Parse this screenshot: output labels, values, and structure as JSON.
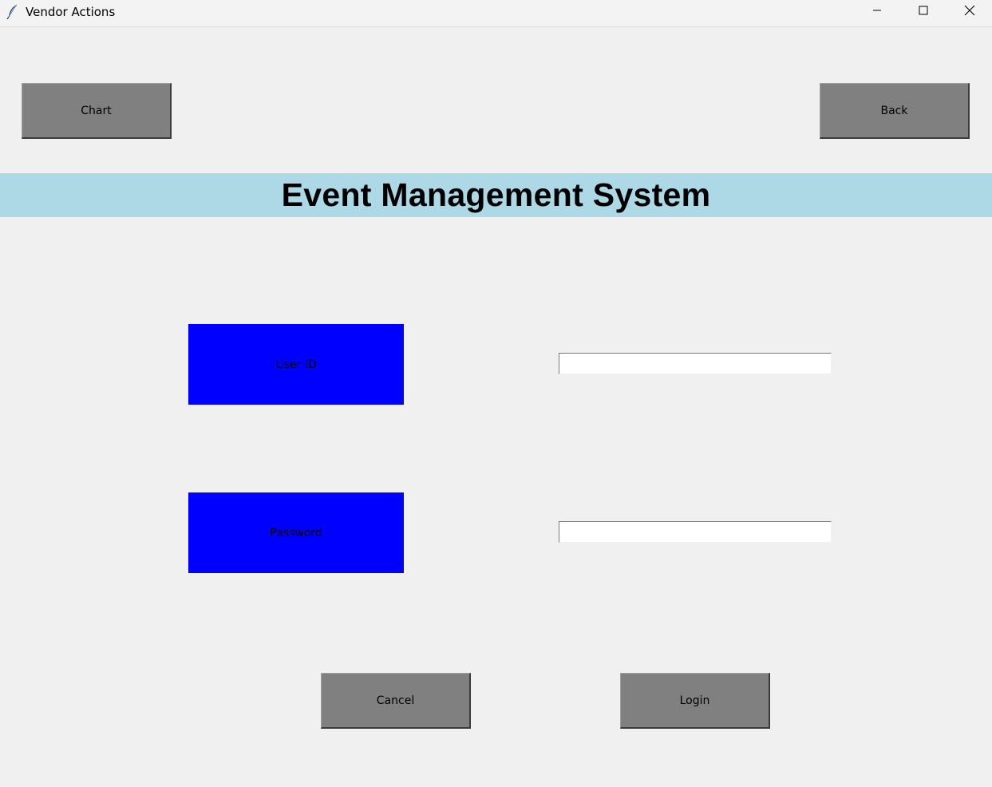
{
  "window": {
    "title": "Vendor Actions",
    "icon": "feather-icon"
  },
  "controls": {
    "minimize_icon": "minimize-icon",
    "maximize_icon": "maximize-icon",
    "close_icon": "close-icon"
  },
  "toolbar": {
    "chart_label": "Chart",
    "back_label": "Back"
  },
  "header": {
    "title": "Event Management System",
    "background": "#add8e6"
  },
  "form": {
    "userid_label": "User ID",
    "password_label": "Password",
    "userid_value": "",
    "password_value": "",
    "label_color": "#0000ff"
  },
  "actions": {
    "cancel_label": "Cancel",
    "login_label": "Login"
  },
  "colors": {
    "button": "#808080",
    "window_bg": "#f0f0f0"
  }
}
